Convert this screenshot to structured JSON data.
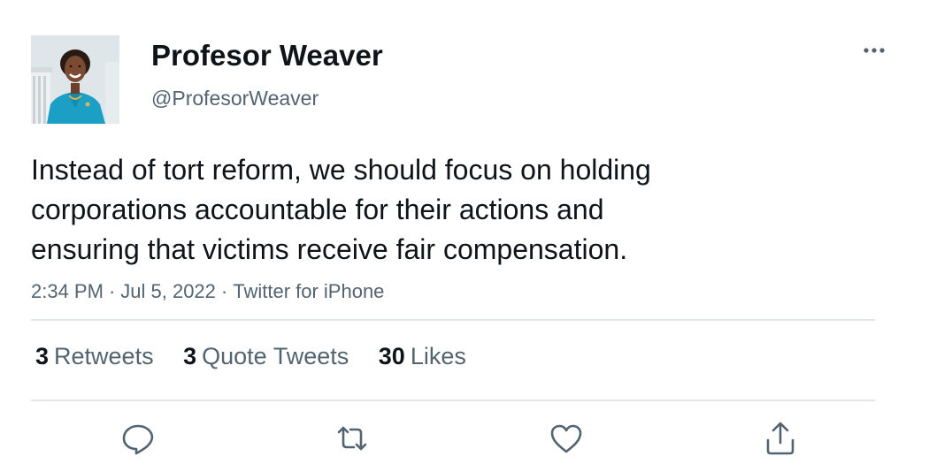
{
  "author": {
    "display_name": "Profesor Weaver",
    "handle": "@ProfesorWeaver",
    "avatar_icon": "profile-photo"
  },
  "tweet": {
    "text_lines": [
      "Instead of tort reform, we should focus on holding",
      "corporations accountable for their actions and",
      "ensuring that victims receive fair compensation."
    ],
    "time": "2:34 PM",
    "date": "Jul 5, 2022",
    "source": "Twitter for iPhone",
    "separator": "·"
  },
  "stats": [
    {
      "count": "3",
      "label": "Retweets"
    },
    {
      "count": "3",
      "label": "Quote Tweets"
    },
    {
      "count": "30",
      "label": "Likes"
    }
  ],
  "actions": [
    {
      "name": "reply",
      "icon": "comment-icon"
    },
    {
      "name": "retweet",
      "icon": "retweet-icon"
    },
    {
      "name": "like",
      "icon": "heart-icon"
    },
    {
      "name": "share",
      "icon": "share-icon"
    }
  ],
  "colors": {
    "text_primary": "#0f1419",
    "text_secondary": "#536471",
    "divider": "#e1e6e9",
    "icon": "#536471"
  }
}
